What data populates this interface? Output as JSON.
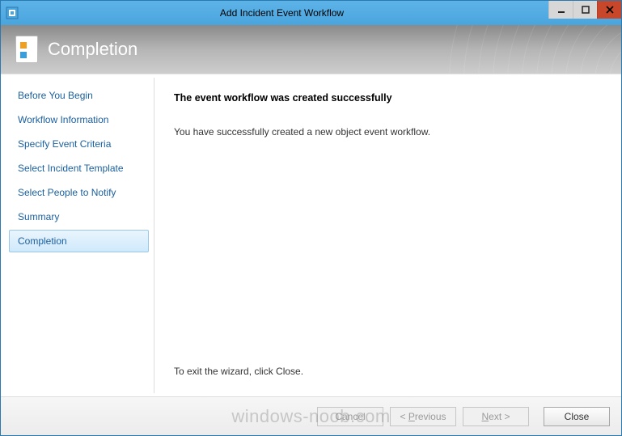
{
  "window": {
    "title": "Add Incident Event Workflow"
  },
  "header": {
    "title": "Completion"
  },
  "sidebar": {
    "items": [
      {
        "label": "Before You Begin",
        "active": false
      },
      {
        "label": "Workflow Information",
        "active": false
      },
      {
        "label": "Specify Event Criteria",
        "active": false
      },
      {
        "label": "Select Incident Template",
        "active": false
      },
      {
        "label": "Select People to Notify",
        "active": false
      },
      {
        "label": "Summary",
        "active": false
      },
      {
        "label": "Completion",
        "active": true
      }
    ]
  },
  "content": {
    "heading": "The event workflow was created successfully",
    "message": "You have successfully created a new object event workflow.",
    "exit_hint": "To exit the wizard, click Close."
  },
  "footer": {
    "cancel": "Cancel",
    "previous": "< Previous",
    "next": "Next >",
    "close": "Close"
  },
  "watermark": "windows-noob.com"
}
